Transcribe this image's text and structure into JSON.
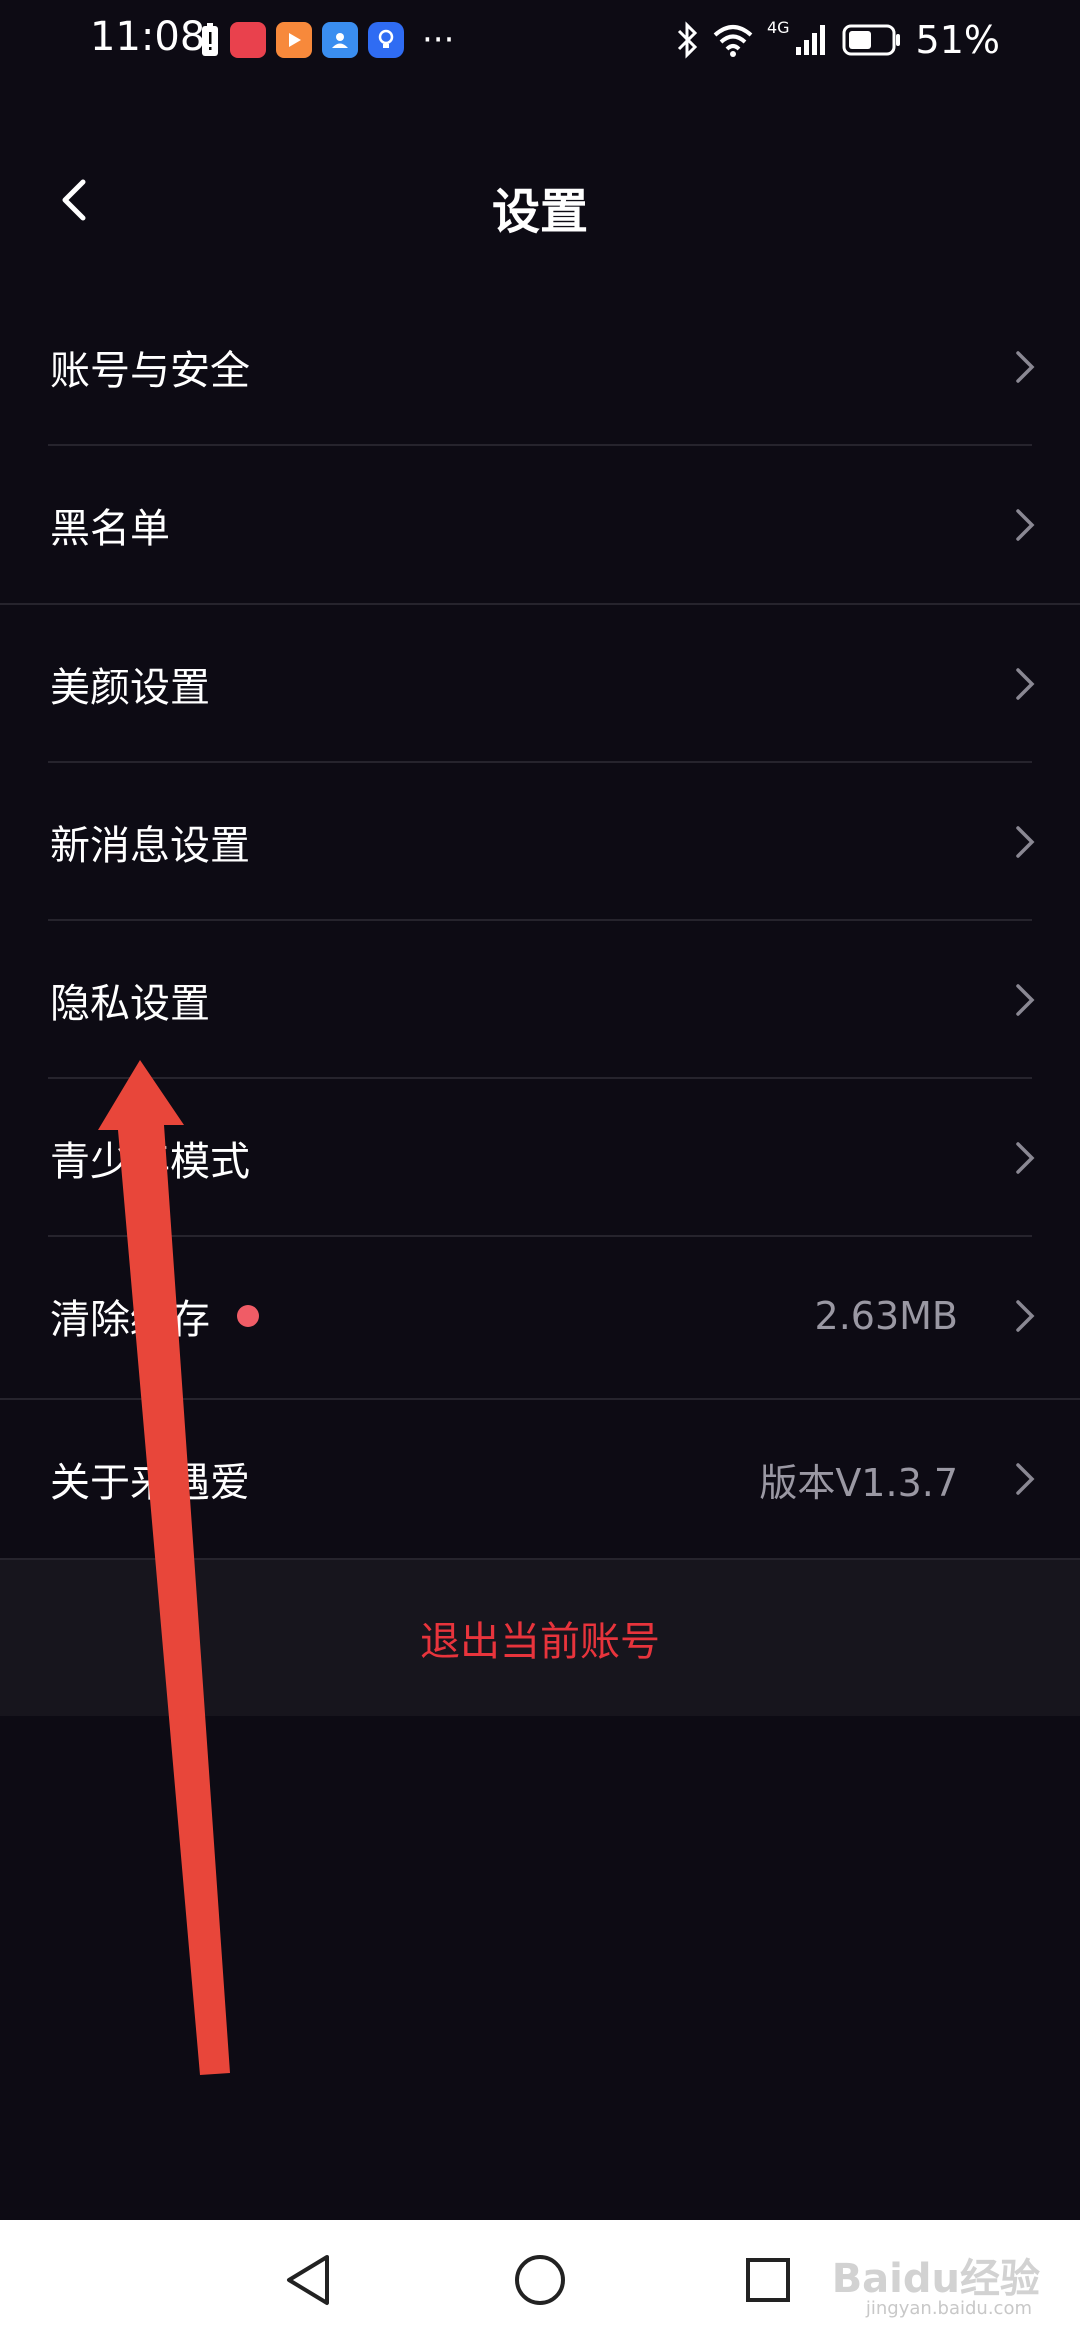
{
  "status_bar": {
    "time": "11:08",
    "notification_icons": [
      "battery-alert-icon",
      "huawei-store-icon",
      "video-app-icon",
      "contacts-app-icon",
      "bulb-app-icon"
    ],
    "more": "···",
    "battery": "51%",
    "network": "4G",
    "colors": {
      "huawei": "#e9414d",
      "video": "#f7893b",
      "contacts": "#3a8ef0",
      "bulb": "#2f6cf3"
    }
  },
  "header": {
    "title": "设置"
  },
  "settings": {
    "account_security": "账号与安全",
    "blacklist": "黑名单",
    "beauty": "美颜设置",
    "new_message": "新消息设置",
    "privacy": "隐私设置",
    "teen_mode": "青少年模式",
    "clear_cache": "清除缓存",
    "cache_size": "2.63MB",
    "about": "关于来遇爱",
    "version": "版本V1.3.7"
  },
  "logout": {
    "label": "退出当前账号",
    "color": "#e8343c"
  },
  "annotation": {
    "arrow_color": "#e8463a"
  },
  "watermark": {
    "text": "Baidu经验",
    "sub": "jingyan.baidu.com"
  }
}
